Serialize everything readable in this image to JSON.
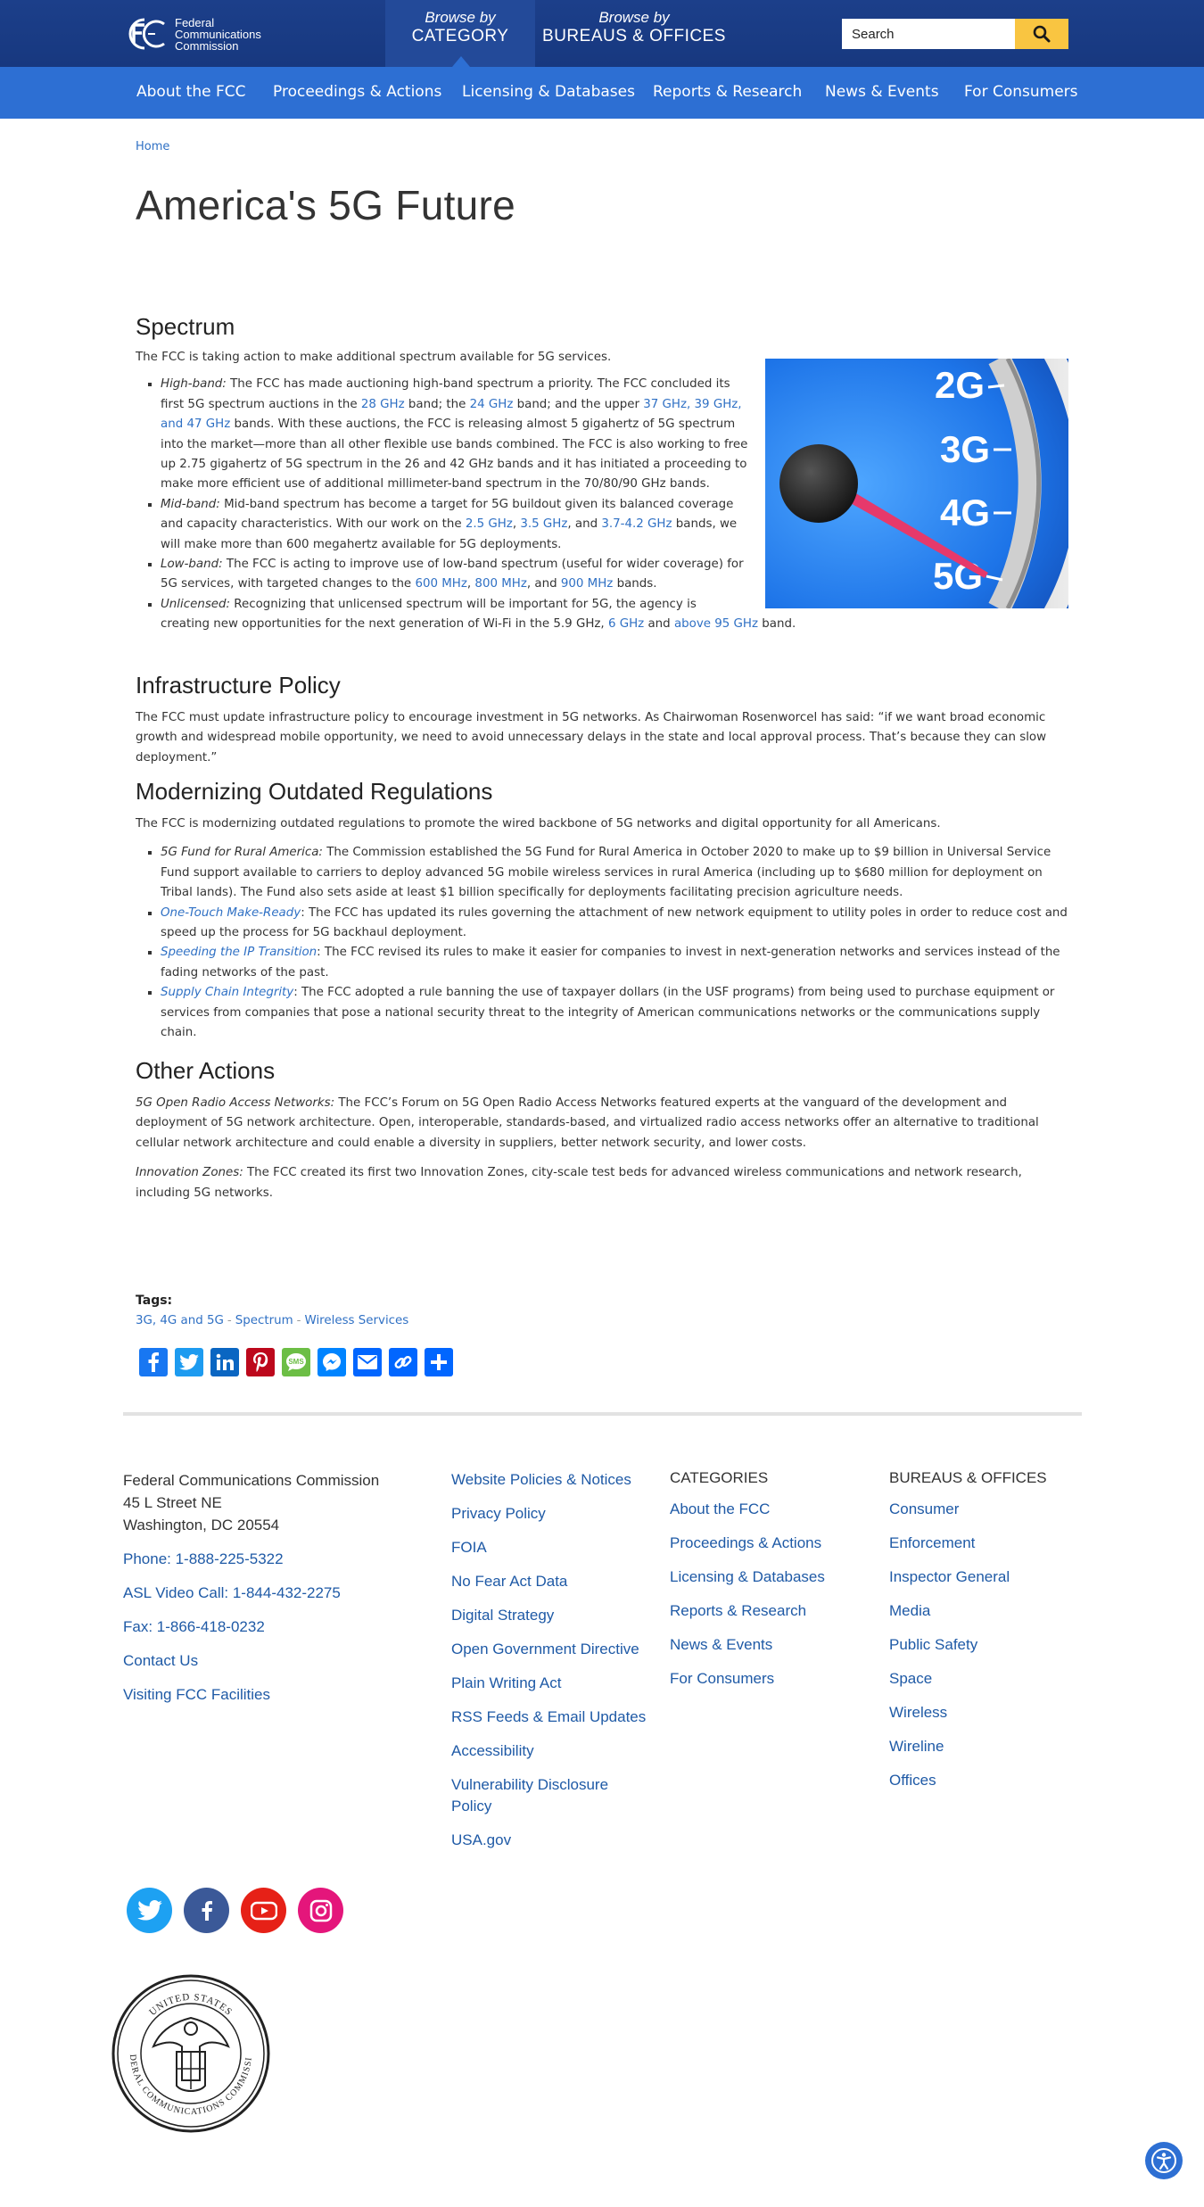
{
  "header": {
    "logo_lines": [
      "Federal",
      "Communications",
      "Commission"
    ],
    "browse_category": {
      "small": "Browse by",
      "big": "CATEGORY"
    },
    "browse_bureaus": {
      "small": "Browse by",
      "big": "BUREAUS & OFFICES"
    },
    "search_placeholder": "Search"
  },
  "nav": [
    "About the FCC",
    "Proceedings & Actions",
    "Licensing & Databases",
    "Reports & Research",
    "News & Events",
    "For Consumers"
  ],
  "breadcrumb": "Home",
  "page_title": "America's 5G Future",
  "spectrum": {
    "heading": "Spectrum",
    "intro": "The FCC is taking action to make additional spectrum available for 5G services.",
    "gauge_labels": [
      "2G",
      "3G",
      "4G",
      "5G"
    ],
    "highband": {
      "label": "High-band:",
      "t1": " The FCC has made auctioning high-band spectrum a priority. The FCC concluded its first 5G spectrum auctions in the ",
      "l1": "28 GHz",
      "t2": " band; the ",
      "l2": "24 GHz",
      "t3": " band; and the upper ",
      "l3": "37 GHz, 39 GHz, and 47 GHz",
      "t4": " bands. With these auctions, the FCC is releasing almost 5 gigahertz of 5G spectrum into the market—more than all other flexible use bands combined. The FCC is also working to free up 2.75 gigahertz of 5G spectrum in the 26 and 42 GHz bands and it has initiated a proceeding to make more efficient use of additional millimeter-band spectrum in the 70/80/90 GHz bands."
    },
    "midband": {
      "label": "Mid-band:",
      "t1": " Mid-band spectrum has become a target for 5G buildout given its balanced coverage and capacity characteristics. With our work on the ",
      "l1": "2.5 GHz",
      "t2": ", ",
      "l2": "3.5 GHz",
      "t3": ", and ",
      "l3": "3.7-4.2 GHz",
      "t4": " bands, we will make more than 600 megahertz available for 5G deployments."
    },
    "lowband": {
      "label": "Low-band:",
      "t1": " The FCC is acting to improve use of low-band spectrum (useful for wider coverage) for 5G services, with targeted changes to the ",
      "l1": "600 MHz",
      "t2": ", ",
      "l2": "800 MHz",
      "t3": ", and ",
      "l3": "900 MHz",
      "t4": " bands."
    },
    "unlicensed": {
      "label": "Unlicensed:",
      "t1": " Recognizing that unlicensed spectrum will be important for 5G, the agency is creating new opportunities for the next generation of Wi-Fi in the 5.9 GHz, ",
      "l1": "6 GHz",
      "t2": " and ",
      "l2": "above 95 GHz",
      "t3": " band."
    }
  },
  "infrastructure": {
    "heading": "Infrastructure Policy",
    "body": "The FCC must update infrastructure policy to encourage investment in 5G networks. As Chairwoman Rosenworcel has said: “if we want broad economic growth and widespread mobile opportunity, we need to avoid unnecessary delays in the state and local approval process. That’s because they can slow deployment.”"
  },
  "modernizing": {
    "heading": "Modernizing Outdated Regulations",
    "intro": "The FCC is modernizing outdated regulations to promote the wired backbone of 5G networks and digital opportunity for all Americans.",
    "items": [
      {
        "label": "5G Fund for Rural America:",
        "text": " The Commission established the 5G Fund for Rural America in October 2020 to make up to $9 billion in Universal Service Fund support available to carriers to deploy advanced 5G mobile wireless services in rural America (including up to $680 million for deployment on Tribal lands). The Fund also sets aside at least $1 billion specifically for deployments facilitating precision agriculture needs."
      },
      {
        "label": "One-Touch Make-Ready",
        "text": ": The FCC has updated its rules governing the attachment of new network equipment to utility poles in order to reduce cost and speed up the process for 5G backhaul deployment."
      },
      {
        "label": "Speeding the IP Transition",
        "text": ": The FCC revised its rules to make it easier for companies to invest in next-generation networks and services instead of the fading networks of the past."
      },
      {
        "label": "Supply Chain Integrity",
        "text": ": The FCC adopted a rule banning the use of taxpayer dollars (in the USF programs) from being used to purchase equipment or services from companies that pose a national security threat to the integrity of American communications networks or the communications supply chain."
      }
    ]
  },
  "other": {
    "heading": "Other Actions",
    "p1_label": "5G Open Radio Access Networks:",
    "p1_text": " The FCC’s Forum on 5G Open Radio Access Networks featured experts at the vanguard of the development and deployment of 5G network architecture. Open, interoperable, standards-based, and virtualized radio access networks offer an alternative to traditional cellular network architecture and could enable a diversity in suppliers, better network security, and lower costs.",
    "p2_label": "Innovation Zones:",
    "p2_text": " The FCC created its first two Innovation Zones, city-scale test beds for advanced wireless communications and network research, including 5G networks."
  },
  "tags": {
    "label": "Tags:",
    "items": [
      "3G, 4G and 5G",
      "Spectrum",
      "Wireless Services"
    ],
    "separator": "-"
  },
  "share_buttons": [
    "facebook-icon",
    "twitter-icon",
    "linkedin-icon",
    "pinterest-icon",
    "sms-icon",
    "messenger-icon",
    "email-icon",
    "copy-link-icon",
    "share-icon"
  ],
  "colors": {
    "navy": "#17387f",
    "blue": "#2d6fd3",
    "yellow": "#f9c541",
    "link": "#2f70c4"
  },
  "footer": {
    "address": [
      "Federal Communications Commission",
      "45 L Street NE",
      "Washington, DC 20554"
    ],
    "contact_links": [
      "Phone: 1-888-225-5322",
      "ASL Video Call: 1-844-432-2275",
      "Fax: 1-866-418-0232",
      "Contact Us",
      "Visiting FCC Facilities"
    ],
    "policy_links": [
      "Website Policies & Notices",
      "Privacy Policy",
      "FOIA",
      "No Fear Act Data",
      "Digital Strategy",
      "Open Government Directive",
      "Plain Writing Act",
      "RSS Feeds & Email Updates",
      "Accessibility",
      "Vulnerability Disclosure Policy",
      "USA.gov"
    ],
    "categories_header": "CATEGORIES",
    "categories": [
      "About the FCC",
      "Proceedings & Actions",
      "Licensing & Databases",
      "Reports & Research",
      "News & Events",
      "For Consumers"
    ],
    "bureaus_header": "BUREAUS & OFFICES",
    "bureaus": [
      "Consumer",
      "Enforcement",
      "Inspector General",
      "Media",
      "Public Safety",
      "Space",
      "Wireless",
      "Wireline",
      "Offices"
    ],
    "social": [
      "twitter-icon",
      "facebook-icon",
      "youtube-icon",
      "instagram-icon"
    ],
    "seal_text": [
      "UNITED STATES",
      "FEDERAL COMMUNICATIONS COMMISSION"
    ]
  }
}
